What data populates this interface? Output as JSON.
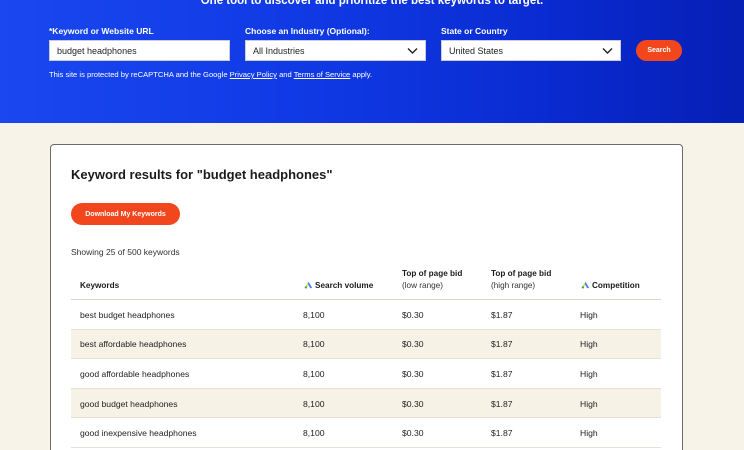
{
  "hero": {
    "tagline": "One tool to discover and prioritize the best keywords to target.",
    "keyword_label": "*Keyword or Website URL",
    "keyword_value": "budget headphones",
    "industry_label": "Choose an Industry (Optional):",
    "industry_value": "All Industries",
    "country_label": "State or Country",
    "country_value": "United States",
    "search_label": "Search",
    "notice_prefix": "This site is protected by reCAPTCHA and the Google",
    "privacy_link": "Privacy Policy",
    "notice_and": "and",
    "terms_link": "Terms of Service",
    "notice_suffix": "apply."
  },
  "results": {
    "title": "Keyword results for \"budget headphones\"",
    "download_label": "Download My Keywords",
    "showing_text": "Showing 25 of 500 keywords",
    "columns": {
      "keywords": "Keywords",
      "volume": "Search volume",
      "bid_low_top": "Top of page bid",
      "bid_low_sub": "(low range)",
      "bid_high_top": "Top of page bid",
      "bid_high_sub": "(high range)",
      "competition": "Competition"
    },
    "rows": [
      {
        "keyword": "best budget headphones",
        "volume": "8,100",
        "bid_low": "$0.30",
        "bid_high": "$1.87",
        "competition": "High"
      },
      {
        "keyword": "best affordable headphones",
        "volume": "8,100",
        "bid_low": "$0.30",
        "bid_high": "$1.87",
        "competition": "High"
      },
      {
        "keyword": "good affordable headphones",
        "volume": "8,100",
        "bid_low": "$0.30",
        "bid_high": "$1.87",
        "competition": "High"
      },
      {
        "keyword": "good budget headphones",
        "volume": "8,100",
        "bid_low": "$0.30",
        "bid_high": "$1.87",
        "competition": "High"
      },
      {
        "keyword": "good inexpensive headphones",
        "volume": "8,100",
        "bid_low": "$0.30",
        "bid_high": "$1.87",
        "competition": "High"
      }
    ]
  },
  "icons": {
    "select_chevron": "chevron-down-icon",
    "ads_metric": "google-ads-icon"
  },
  "colors": {
    "hero_blue": "#0f38e3",
    "accent_orange": "#f2471c",
    "page_cream": "#f7f3e8",
    "row_alt": "#f6f2e6"
  }
}
